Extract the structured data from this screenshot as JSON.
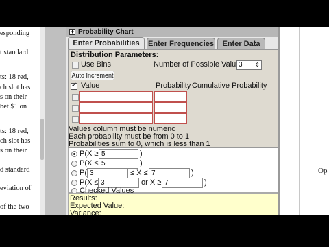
{
  "left_doc": {
    "lines": [
      "esponding",
      "t standard",
      "ts: 18 red,",
      "ch slot has",
      "s on their",
      "bet $1 on",
      "ts: 18 red,",
      "ch slot has",
      "s on their",
      "d standard",
      "eviation of",
      "of the two"
    ]
  },
  "right_doc": {
    "text": "Op"
  },
  "applet": {
    "title": "Probability Chart",
    "title_toggle": "+",
    "tabs": [
      {
        "label": "Enter Probabilities",
        "active": true
      },
      {
        "label": "Enter Frequencies",
        "active": false
      },
      {
        "label": "Enter Data",
        "active": false
      }
    ],
    "params": {
      "heading": "Distribution Parameters:",
      "use_bins_label": "Use Bins",
      "num_values_label": "Number of Possible Values",
      "num_values": "3",
      "auto_increment_label": "Auto Increment",
      "col_value": "Value",
      "col_probability": "Probability",
      "col_cumulative": "Cumulative Probability",
      "messages": [
        "Values column must be numeric",
        "Each probability must be from 0 to 1",
        "Probabilities sum to 0, which is less than 1"
      ]
    },
    "options": {
      "opt1_prefix": "P(X ≥",
      "opt1_value": "5",
      "opt1_suffix": ")",
      "opt2_prefix": "P(X ≤",
      "opt2_value": "5",
      "opt2_suffix": ")",
      "opt3_prefix": "P(",
      "opt3_value_a": "3",
      "opt3_mid": "≤ X ≤",
      "opt3_value_b": "7",
      "opt3_suffix": ")",
      "opt4_prefix": "P(X ≤",
      "opt4_value_a": "3",
      "opt4_mid": "or X ≥",
      "opt4_value_b": "7",
      "opt4_suffix": ")",
      "opt5_label": "Checked Values"
    },
    "results": {
      "results_label": "Results:",
      "expected_label": "Expected Value:",
      "variance_label": "Variance:"
    }
  }
}
